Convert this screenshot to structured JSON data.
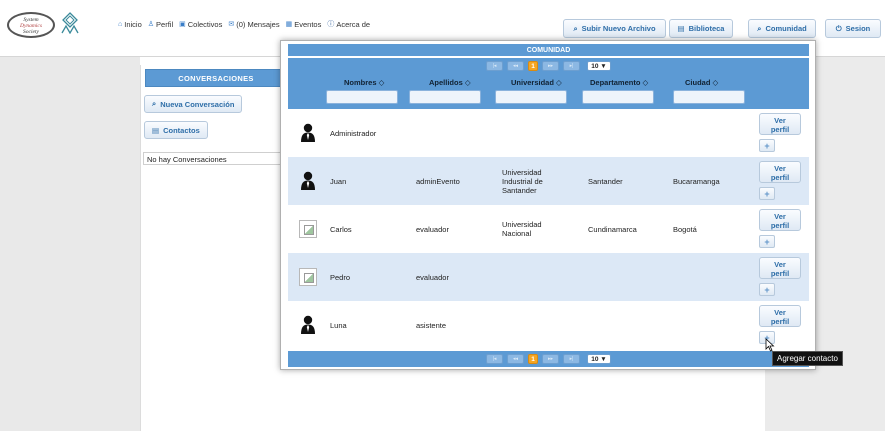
{
  "logo": {
    "line1": "System",
    "line2": "Dynamics",
    "line3": "Society"
  },
  "nav": [
    {
      "label": "Inicio",
      "icon": "home-icon",
      "glyph": "⌂"
    },
    {
      "label": "Perfil",
      "icon": "user-icon",
      "glyph": "♙"
    },
    {
      "label": "Colectivos",
      "icon": "group-icon",
      "glyph": "▣"
    },
    {
      "label": "(0) Mensajes",
      "icon": "mail-icon",
      "glyph": "✉"
    },
    {
      "label": "Eventos",
      "icon": "calendar-icon",
      "glyph": "▦"
    },
    {
      "label": "Acerca de",
      "icon": "info-icon",
      "glyph": "ⓘ"
    }
  ],
  "top_buttons": {
    "upload": "Subir Nuevo Archivo",
    "library": "Biblioteca",
    "community": "Comunidad",
    "session": "Sesion"
  },
  "sidebar": {
    "header": "CONVERSACIONES",
    "new_conversation": "Nueva Conversación",
    "contacts": "Contactos",
    "empty_text": "No hay Conversaciones"
  },
  "modal": {
    "title": "COMUNIDAD",
    "pager": {
      "current_page": "1",
      "page_size": "10 ▼"
    },
    "columns": {
      "nombres": "Nombres ◇",
      "apellidos": "Apellidos ◇",
      "universidad": "Universidad ◇",
      "departamento": "Departamento ◇",
      "ciudad": "Ciudad ◇"
    },
    "view_profile_line1": "Ver",
    "view_profile_line2": "perfil",
    "add_glyph": "+",
    "rows": [
      {
        "nombre": "Administrador",
        "apellido": "",
        "universidad": "",
        "departamento": "",
        "ciudad": "",
        "avatar": "silhouette"
      },
      {
        "nombre": "Juan",
        "apellido": "adminEvento",
        "universidad": "Universidad Industrial de Santander",
        "departamento": "Santander",
        "ciudad": "Bucaramanga",
        "avatar": "silhouette"
      },
      {
        "nombre": "Carlos",
        "apellido": "evaluador",
        "universidad": "Universidad Nacional",
        "departamento": "Cundinamarca",
        "ciudad": "Bogotá",
        "avatar": "broken-image"
      },
      {
        "nombre": "Pedro",
        "apellido": "evaluador",
        "universidad": "",
        "departamento": "",
        "ciudad": "",
        "avatar": "broken-image"
      },
      {
        "nombre": "Luna",
        "apellido": "asistente",
        "universidad": "",
        "departamento": "",
        "ciudad": "",
        "avatar": "silhouette"
      }
    ]
  },
  "tooltip": "Agregar contacto",
  "colors": {
    "accent_blue": "#5c9ad4",
    "current_page": "#f5a623",
    "row_alt": "#dce8f6"
  }
}
